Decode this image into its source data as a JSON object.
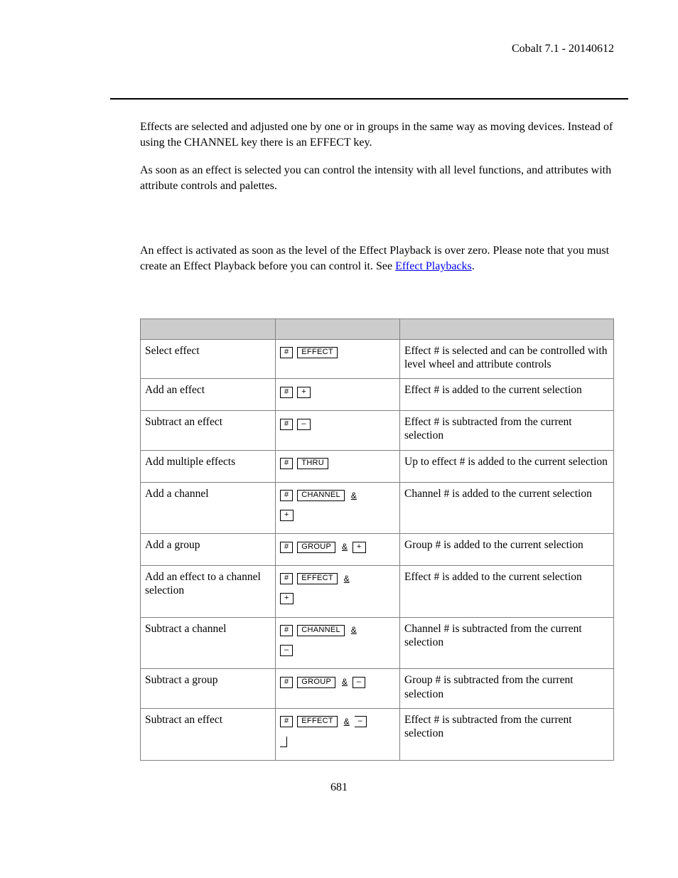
{
  "header": "Cobalt 7.1 - 20140612",
  "para1": "Effects are selected and adjusted one by one or in groups in the same way as moving devices. Instead of using the CHANNEL key there is an EFFECT key.",
  "para2": "As soon as an effect is selected you can control the intensity with all level functions, and attributes with attribute controls and palettes.",
  "para3a": "An effect is activated as soon as the level of the Effect Playback is over zero. Please note that you must create an Effect Playback before you can control it. See ",
  "link": "Effect Playbacks",
  "para3b": ".",
  "keys": {
    "hash": "#",
    "effect": "EFFECT",
    "plus": "+",
    "minus": "–",
    "thru": "THRU",
    "channel": "CHANNEL",
    "group": "GROUP",
    "amp": "&"
  },
  "rows": [
    {
      "action": "Select effect",
      "desc": "Effect # is selected and can be controlled with level wheel and attribute controls"
    },
    {
      "action": "Add an effect",
      "desc": "Effect # is added to the current selection"
    },
    {
      "action": "Subtract an effect",
      "desc": "Effect # is subtracted from the current selection"
    },
    {
      "action": "Add multiple effects",
      "desc": "Up to effect # is added to the current selection"
    },
    {
      "action": "Add a channel",
      "desc": "Channel # is added to the current selection"
    },
    {
      "action": "Add a group",
      "desc": "Group # is added to the current selection"
    },
    {
      "action": "Add an effect to a channel selection",
      "desc": "Effect # is added to the current selection"
    },
    {
      "action": "Subtract a channel",
      "desc": "Channel # is subtracted from the current selection"
    },
    {
      "action": "Subtract a group",
      "desc": "Group # is subtracted from the current selection"
    },
    {
      "action": "Subtract an effect",
      "desc": "Effect # is subtracted from the current selection"
    }
  ],
  "pagenum": "681"
}
